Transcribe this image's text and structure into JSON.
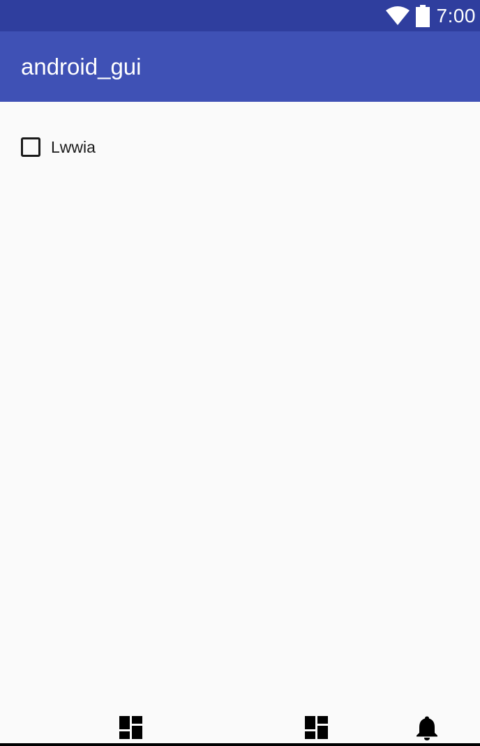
{
  "status_bar": {
    "time": "7:00",
    "icons": [
      "wifi-icon",
      "battery-icon"
    ]
  },
  "app_bar": {
    "title": "android_gui"
  },
  "content": {
    "checkbox": {
      "label": "Lwwia",
      "checked": false
    }
  },
  "bottom_nav": {
    "items": [
      {
        "icon": "dashboard-icon"
      },
      {
        "icon": "dashboard-icon"
      },
      {
        "icon": "notifications-icon"
      }
    ]
  },
  "colors": {
    "status_bar": "#2f3e9e",
    "app_bar": "#3f51b5",
    "background": "#fafafa",
    "text": "#1a1a1a"
  }
}
